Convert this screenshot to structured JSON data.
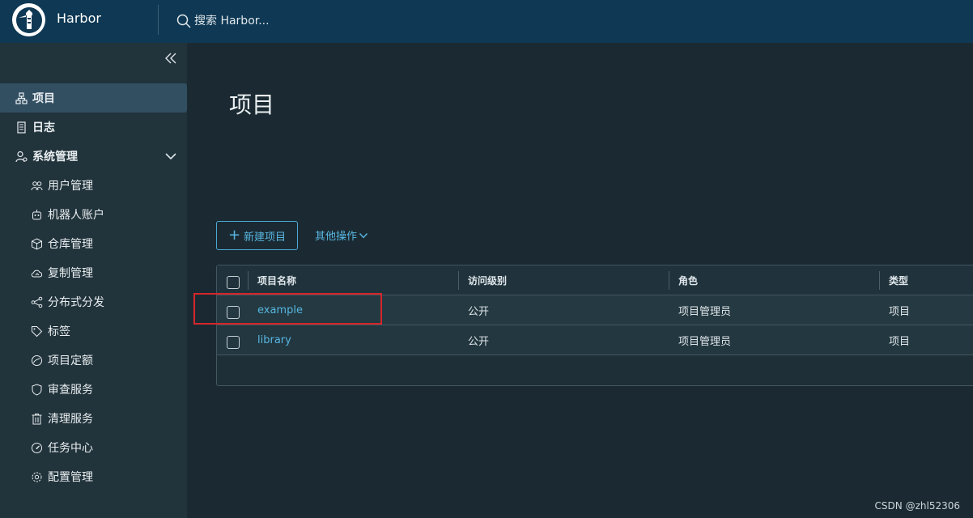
{
  "header": {
    "brand": "Harbor",
    "search_placeholder": "搜索 Harbor..."
  },
  "sidebar": {
    "items": [
      {
        "label": "项目",
        "icon": "projects-icon"
      },
      {
        "label": "日志",
        "icon": "log-icon"
      },
      {
        "label": "系统管理",
        "icon": "admin-icon"
      }
    ],
    "subitems": [
      {
        "label": "用户管理",
        "icon": "users-icon"
      },
      {
        "label": "机器人账户",
        "icon": "robot-icon"
      },
      {
        "label": "仓库管理",
        "icon": "registry-icon"
      },
      {
        "label": "复制管理",
        "icon": "cloud-replication-icon"
      },
      {
        "label": "分布式分发",
        "icon": "share-icon"
      },
      {
        "label": "标签",
        "icon": "tag-icon"
      },
      {
        "label": "项目定额",
        "icon": "quota-gauge-icon"
      },
      {
        "label": "审查服务",
        "icon": "shield-icon"
      },
      {
        "label": "清理服务",
        "icon": "trash-icon"
      },
      {
        "label": "任务中心",
        "icon": "dashboard-icon"
      },
      {
        "label": "配置管理",
        "icon": "gear-icon"
      }
    ]
  },
  "main": {
    "title": "项目",
    "new_project_label": "新建项目",
    "other_actions_label": "其他操作",
    "table": {
      "columns": [
        "项目名称",
        "访问级别",
        "角色",
        "类型"
      ],
      "rows": [
        {
          "name": "example",
          "access": "公开",
          "role": "项目管理员",
          "type": "项目"
        },
        {
          "name": "library",
          "access": "公开",
          "role": "项目管理员",
          "type": "项目"
        }
      ]
    }
  },
  "watermark": "CSDN @zhl52306",
  "colors": {
    "header_bg": "#0e3854",
    "sidebar_bg": "#21333b",
    "main_bg": "#1b2a32",
    "accent": "#58b6e2",
    "highlight": "#d6262b"
  }
}
